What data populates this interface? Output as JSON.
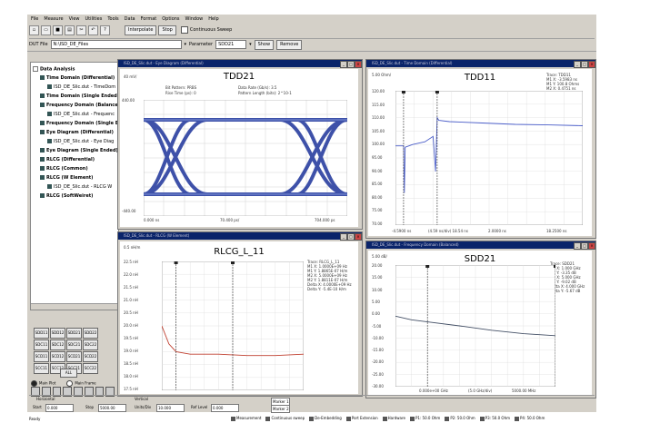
{
  "menu": [
    "File",
    "Measure",
    "View",
    "Utilities",
    "Tools",
    "Data",
    "Format",
    "Options",
    "Window",
    "Help"
  ],
  "toolbar": {
    "icons": [
      "new-icon",
      "open-icon",
      "save-icon",
      "print-icon",
      "cut-icon",
      "undo-icon",
      "help-icon"
    ],
    "interpolate": "Interpolate",
    "stop": "Stop",
    "continuous": "Continuous Sweep"
  },
  "file_row": {
    "dut_label": "DUT File",
    "dut_value": "N:\\ISD_DE_Files",
    "param_label": "Parameter",
    "param_value": "SDD21",
    "show_label": "Show",
    "remove_label": "Remove"
  },
  "tree": [
    {
      "label": "Data Analysis",
      "bold": true
    },
    {
      "label": "Time Domain (Differential)",
      "bold": true
    },
    {
      "label": "ISD_DE_Slic.dut - TimeDom",
      "bold": false
    },
    {
      "label": "Time Domain (Single Ended)",
      "bold": true
    },
    {
      "label": "Frequency Domain (Balance",
      "bold": true
    },
    {
      "label": "ISD_DE_Slic.dut - Frequenc",
      "bold": false
    },
    {
      "label": "Frequency Domain (Single E",
      "bold": true
    },
    {
      "label": "Eye Diagram (Differential)",
      "bold": true
    },
    {
      "label": "ISD_DE_Slic.dut - Eye Diag",
      "bold": false
    },
    {
      "label": "Eye Diagram (Single Ended)",
      "bold": true
    },
    {
      "label": "RLCG (Differential)",
      "bold": true
    },
    {
      "label": "RLCG (Common)",
      "bold": true
    },
    {
      "label": "RLCG (W Element)",
      "bold": true
    },
    {
      "label": "ISD_DE_Slic.dut - RLCG W",
      "bold": false
    },
    {
      "label": "RLCG (SoftWeiret)",
      "bold": true
    }
  ],
  "params": [
    "SDD11",
    "SDD12",
    "SDD21",
    "SDD22",
    "SDC11",
    "SDC12",
    "SDC21",
    "SDC22",
    "SCD11",
    "SCD12",
    "SCD21",
    "SCD22",
    "SCC11",
    "SCC12",
    "SCC21",
    "SCC22"
  ],
  "all_label": "ALL",
  "radios": [
    {
      "label": "Main Plot",
      "on": true
    },
    {
      "label": "Main Frame",
      "on": false
    }
  ],
  "windows": [
    {
      "title": "ISD_DE_Slic.dut - Eye Diagram (Differential)",
      "plot_title": "TDD21",
      "info": [
        "Bit Pattern: PRBS",
        "Data Rate (Gb/s): 3.5",
        "Rise Time (ps): 0",
        "Pattern Length (bits): 2^10-1"
      ],
      "yticks": [
        "440.00",
        "-440.00"
      ],
      "ytop": "40 mV/",
      "xticks": [
        "0.000 ns",
        "70.400 ps/",
        "704.000 ps"
      ]
    },
    {
      "title": "ISD_DE_Slic.dut - Time Domain (Differential)",
      "plot_title": "TDD11",
      "ytop": "5.00 Ohm/",
      "yticks": [
        "120.00",
        "115.00",
        "110.00",
        "105.00",
        "100.00",
        "95.00",
        "90.00",
        "85.00",
        "80.00",
        "75.00",
        "70.00"
      ],
      "xticks": [
        "-4.5900 ns",
        "(4.59 ns/div) 18.54 ns",
        "2.0000 ns",
        "18.2500 ns"
      ],
      "markers": [
        "Trace: TDD11",
        "M1 X: -3.5983 ns",
        "M1 Y: 100.8 Ohms",
        "M2 X: 0.4751 ns",
        "M2 Y: 100.0 Ohms",
        "Delta X: 4.1036 ns",
        "Delta Y: 0.75 Ohms"
      ]
    },
    {
      "title": "ISD_DE_Slic.dut - RLCG (W Element)",
      "plot_title": "RLCG_L_11",
      "ytop": "0.5 nH/m",
      "yticks": [
        "22.5 nH",
        "22.0 nH",
        "21.5 nH",
        "21.0 nH",
        "20.5 nH",
        "20.0 nH",
        "19.5 nH",
        "19.0 nH",
        "18.5 nH",
        "18.0 nH",
        "17.5 nH"
      ],
      "markers": [
        "Trace: RLCG_L_11",
        "M1 X: 1.0000E+09 Hz",
        "M1 Y: 1.8865E-07 H/m",
        "M2 X: 5.0000E+09 Hz",
        "M2 Y: 1.8811E-07 H/m",
        "Delta X: 4.0000E+09 Hz",
        "Delta Y: -5.4E-10 H/m"
      ]
    },
    {
      "title": "ISD_DE_Slic.dut - Frequency Domain (Balanced)",
      "plot_title": "SDD21",
      "ytop": "5.00 dB/",
      "yticks": [
        "20.00",
        "15.00",
        "10.00",
        "5.00",
        "0.00",
        "-5.00",
        "-10.00",
        "-15.00",
        "-20.00",
        "-25.00",
        "-30.00"
      ],
      "xticks": [
        "0.000e+00 GHz",
        "(5.0 GHz/div)",
        "5000.00 MHz"
      ],
      "markers": [
        "Trace: SDD21",
        "M1 X: 1.000 GHz",
        "M1 Y: -3.35 dB",
        "M2 X: 5.000 GHz",
        "M2 Y: -9.02 dB",
        "Delta X: 4.000 GHz",
        "Delta Y: -5.67 dB"
      ]
    }
  ],
  "chart_data": [
    {
      "type": "line",
      "title": "TDD11",
      "ylabel": "5.00 Ohm/",
      "ylim": [
        70,
        120
      ],
      "x": [
        -4.59,
        -3.6,
        -3.5,
        -3.4,
        -2.5,
        -1.0,
        0.0,
        0.3,
        0.5,
        0.7,
        2.0,
        6.0,
        10.0,
        14.0,
        18.25
      ],
      "values": [
        99.5,
        99.5,
        82.0,
        99.0,
        100.0,
        101.0,
        103.0,
        90.0,
        110.0,
        109.0,
        108.5,
        108.0,
        107.5,
        107.3,
        107.0
      ]
    },
    {
      "type": "line",
      "title": "RLCG_L_11",
      "ylim": [
        17.5,
        22.5
      ],
      "x": [
        0,
        0.5,
        1,
        2,
        4,
        6,
        8,
        10
      ],
      "values": [
        20.0,
        19.3,
        19.0,
        18.9,
        18.9,
        18.85,
        18.85,
        18.9
      ]
    },
    {
      "type": "line",
      "title": "SDD21",
      "ylabel": "5.00 dB/",
      "ylim": [
        -30,
        20
      ],
      "x": [
        0,
        0.5,
        1,
        2,
        3,
        4,
        5
      ],
      "values": [
        -1.0,
        -2.5,
        -3.35,
        -5.0,
        -6.8,
        -8.2,
        -9.02
      ]
    }
  ],
  "bottom": {
    "horizontal": "Horizontal",
    "start_label": "Start",
    "start_value": "0.000",
    "stop_label": "Stop",
    "stop_value": "5000.00",
    "vertical": "Vertical",
    "units_label": "Units/Div",
    "units_value": "10.000",
    "ref_label": "Ref Level",
    "ref_value": "0.000",
    "marker1": "Marker 1",
    "marker2": "Marker 2"
  },
  "status": {
    "ready": "Ready",
    "items": [
      "Measurement",
      "Continuous sweep",
      "De-Embedding",
      "Port Extension",
      "Hardware",
      "P1: 50.0 Ohm",
      "P2: 50.0 Ohm",
      "P3: 50.0 Ohm",
      "P4: 50.0 Ohm"
    ]
  }
}
